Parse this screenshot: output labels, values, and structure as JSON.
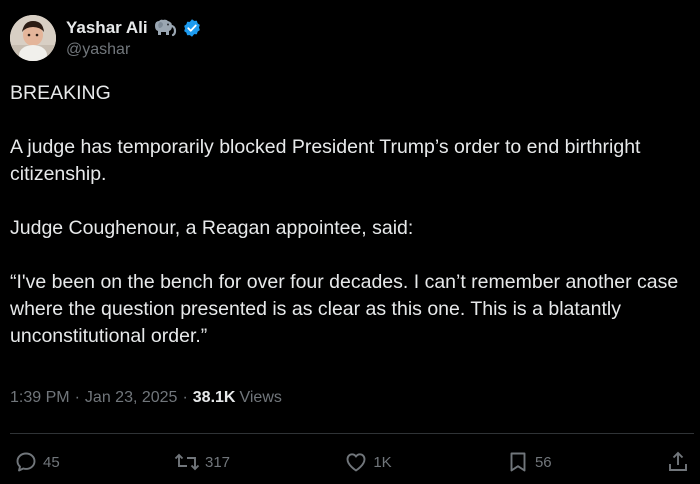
{
  "author": {
    "display_name": "Yashar Ali",
    "handle": "@yashar",
    "emoji_icon": "elephant-icon",
    "verified_icon": "verified-badge-icon"
  },
  "tweet": {
    "paragraphs": [
      "BREAKING",
      "A judge has temporarily blocked President Trump’s order to end birthright citizenship.",
      "Judge Coughenour, a Reagan appointee, said:",
      "“I've been on the bench for over four decades. I can’t remember another case where the question presented is as clear as this one. This is a blatantly unconstitutional order.”"
    ],
    "time": "1:39 PM",
    "date": "Jan 23, 2025",
    "separator": "·",
    "views_count": "38.1K",
    "views_label": "Views"
  },
  "actions": {
    "replies": "45",
    "reposts": "317",
    "likes": "1K",
    "bookmarks": "56"
  },
  "colors": {
    "background": "#000000",
    "text": "#e7e9ea",
    "muted": "#71767b",
    "verified": "#1d9bf0",
    "divider": "#2f3336"
  }
}
